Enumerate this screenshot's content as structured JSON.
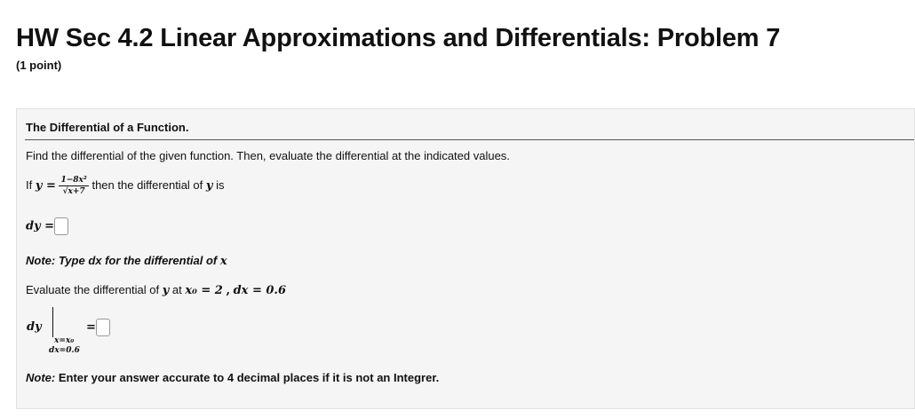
{
  "header": {
    "title": "HW Sec 4.2 Linear Approximations and Differentials: Problem 7",
    "points": "(1 point)"
  },
  "problem": {
    "section_title": "The Differential of a Function.",
    "instruction": "Find the differential of the given function. Then, evaluate the differential at the indicated values.",
    "if_text": "If",
    "y_eq": "y =",
    "frac_num": "1−8x²",
    "frac_den": "√x+7",
    "then_text": "then the differential of",
    "y_var": "y",
    "is_text": "is",
    "dy_label": "dy =",
    "note1_label": "Note:",
    "note1_text": "Type dx for the differential of",
    "note1_var": "x",
    "evaluate_text": "Evaluate the differential of",
    "eval_y": "y",
    "at_text": "at",
    "x0_expr": "x₀ = 2",
    "comma": ",",
    "dx_expr": "dx = 0.6",
    "dy_eval": "dy",
    "cond1": "x=x₀",
    "cond2": "dx=0.6",
    "eval_eq": "=",
    "note2_label": "Note:",
    "note2_text": "Enter your answer accurate to 4 decimal places if it is not an Integrer."
  }
}
